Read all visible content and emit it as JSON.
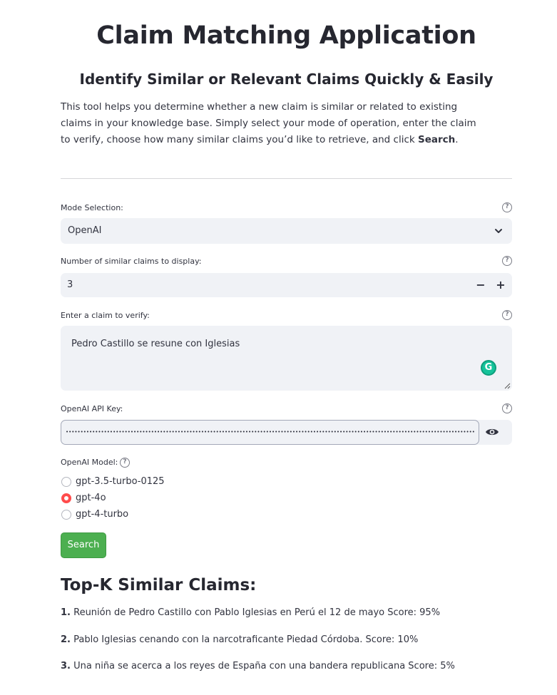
{
  "header": {
    "title": "Claim Matching Application",
    "subtitle": "Identify Similar or Relevant Claims Quickly & Easily",
    "intro_text": "This tool helps you determine whether a new claim is similar or related to existing claims in your knowledge base. Simply select your mode of operation, enter the claim to verify, choose how many similar claims you’d like to retrieve, and click ",
    "intro_bold": "Search",
    "intro_end": "."
  },
  "form": {
    "mode": {
      "label": "Mode Selection:",
      "value": "OpenAI",
      "help_icon": "question-circle-icon"
    },
    "num_claims": {
      "label": "Number of similar claims to display:",
      "value": "3",
      "minus": "−",
      "plus": "+"
    },
    "claim": {
      "label": "Enter a claim to verify:",
      "value": "Pedro Castillo se resune con Iglesias",
      "grammarly_icon": "G"
    },
    "api_key": {
      "label": "OpenAI API Key:",
      "value": "•••••••••••••••••••••••••••••••••••••••••••••••••••••••••••••••••••••••••••••••••••••••••••••••••••••••••••••••••••••••••••••••••••••••••••••••••••••••••••••"
    },
    "model": {
      "label": "OpenAI Model:",
      "options": [
        {
          "label": "gpt-3.5-turbo-0125",
          "selected": false
        },
        {
          "label": "gpt-4o",
          "selected": true
        },
        {
          "label": "gpt-4-turbo",
          "selected": false
        }
      ]
    },
    "search_button": "Search"
  },
  "results": {
    "heading": "Top-K Similar Claims:",
    "items": [
      {
        "num": "1.",
        "text": " Reunión de Pedro Castillo con Pablo Iglesias en Perú el 12 de mayo Score: 95%"
      },
      {
        "num": "2.",
        "text": " Pablo Iglesias cenando con la narcotraficante Piedad Córdoba. Score: 10%"
      },
      {
        "num": "3.",
        "text": " Una niña se acerca a los reyes de España con una bandera republicana Score: 5%"
      }
    ]
  },
  "colors": {
    "accent": "#ff4b4b",
    "button": "#4caf50",
    "input_bg": "#f0f2f6"
  }
}
